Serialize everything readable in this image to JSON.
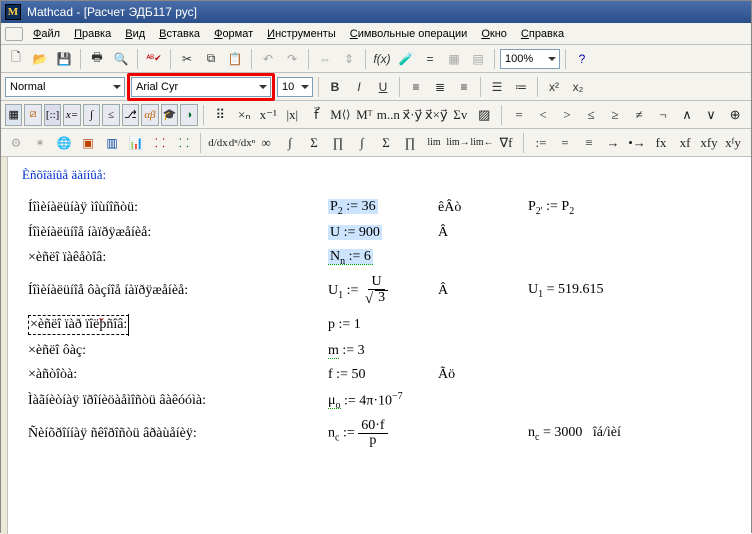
{
  "title": "Mathcad - [Расчет ЭДБ117 рус]",
  "menu": [
    "Файл",
    "Правка",
    "Вид",
    "Вставка",
    "Формат",
    "Инструменты",
    "Символьные операции",
    "Окно",
    "Справка"
  ],
  "format": {
    "style": "Normal",
    "font": "Arial Cyr",
    "font_size": "10",
    "zoom": "100%"
  },
  "toolbar1_icons": [
    "new-icon",
    "open-icon",
    "save-icon",
    "print-icon",
    "preview-icon",
    "spell-icon",
    "cut-icon",
    "copy-icon",
    "paste-icon",
    "undo-icon",
    "redo-icon",
    "align-icon",
    "func-icon",
    "unit-icon",
    "zoom-combo",
    "help-icon"
  ],
  "toolbar2_icons": [
    "bold-label",
    "italic-label",
    "underline-label",
    "align-left",
    "align-center",
    "align-right",
    "bullets",
    "numbers",
    "super",
    "sub"
  ],
  "palette_row1": [
    "calc",
    "graph",
    "vector",
    "eval",
    "calc2",
    "bool",
    "prog",
    "greek",
    "sym",
    "sym2"
  ],
  "sym_row1": [
    "×ₙ",
    "×⁻¹",
    "|×|",
    "n!",
    "ⁿᴵ",
    "Mᵀ",
    "m..n",
    "׳",
    "Σ",
    "∫",
    "d/dx"
  ],
  "sym_row1b": [
    "<",
    ">",
    "≤",
    "≥",
    "≠",
    "¬",
    "∧",
    "∨",
    "⊕"
  ],
  "sym_row2": [
    "÷",
    "Σ",
    "∏",
    "∫",
    "∑",
    "∏",
    "lim",
    "lim",
    "lim",
    "∇f",
    "∞"
  ],
  "sym_row2b": [
    ":=",
    "=",
    "≡",
    "→",
    "→",
    "fx",
    "xf",
    "xfy",
    "xᶠy"
  ],
  "toolbar3_icons": [
    "a",
    "b",
    "c",
    "d",
    "e",
    "f",
    "g",
    "h"
  ],
  "doc": {
    "heading": "Èñõîäíûå äàííûå:",
    "rows": [
      {
        "label": "Íîìèíàëüíàÿ ìîùíîñòü:",
        "eq_html": "<span class='hl'>P<span class='subs'>2</span> := 36</span>",
        "unit": "êÂò",
        "res": "P<span class='subs'>2'</span> := P<span class='subs'>2</span>"
      },
      {
        "label": "Íîìèíàëüíîå íàïðÿæåíèå:",
        "eq_html": "<span class='hl'>U := 900</span>",
        "unit": "Â",
        "res": ""
      },
      {
        "label": "×èñëî ïàêåòîâ:",
        "eq_html": "<span class='hl uwave'>N<span class='subs'>n</span> := 6</span>",
        "unit": "",
        "res": ""
      },
      {
        "label": "Íîìèíàëüíîå ôàçíîå íàïðÿæåíèå:",
        "eq_html": "U<span class='subs'>1</span> := <span class='frac'><span class='num'>U</span><span class='den'><span class='radic'>√</span><span class='sqrt'>3</span></span></span>",
        "unit": "Â",
        "res": "U<span class='subs'>1</span> = 519.615"
      },
      {
        "label_html": "<span class='cursorbox'>×èñëî ïàð ï<span class='tick-red'>ˇ</span>îëþñîâ:</span>",
        "eq_html": "p := 1",
        "unit": "",
        "res": ""
      },
      {
        "label": "×èñëî ôàç:",
        "eq_html": "<span class='uwave'>m</span> := 3",
        "unit": "",
        "res": ""
      },
      {
        "label": "×àñòîòà:",
        "eq_html": "f := 50",
        "unit": "Ãö",
        "res": ""
      },
      {
        "label": "Ìàãíèòíàÿ ïðîíèöàåìîñòü âàêóóìà:",
        "eq_html": "<span class='uwave'>μ<span class='subs'>o</span></span> := 4π·10<span class='sups'>−7</span>",
        "unit": "",
        "res": ""
      },
      {
        "label": "Ñèíõðîííàÿ ñêîðîñòü âðàùåíèÿ:",
        "eq_html": "n<span class='subs'>c</span> := <span class='frac'><span class='num'>60·f</span><span class='den'>p</span></span>",
        "unit": "",
        "res": "n<span class='subs'>c</span> = 3000&nbsp;&nbsp;&nbsp;îá/ìèí"
      }
    ]
  }
}
